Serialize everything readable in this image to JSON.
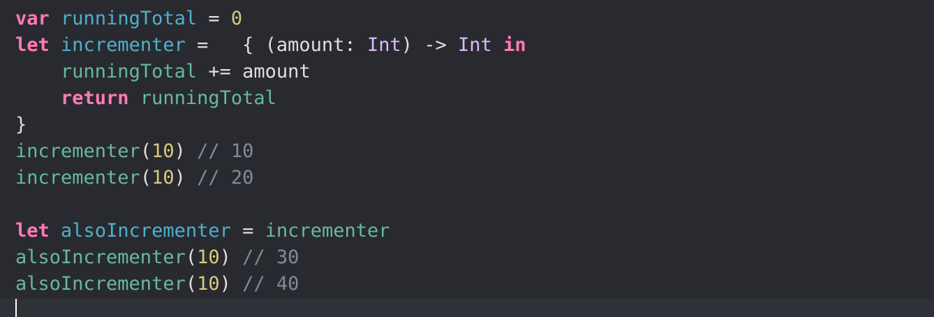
{
  "editor": {
    "lines": [
      {
        "kw": "var",
        "decl": "runningTotal",
        "op": " = ",
        "num": "0"
      },
      {
        "kw": "let",
        "decl": "incrementer",
        "op": " =   { (amount: ",
        "type1": "Int",
        "arrow": ") -> ",
        "type2": "Int",
        "kw2": "in"
      },
      {
        "indent": "    ",
        "ident": "runningTotal",
        "op": " += amount"
      },
      {
        "indent": "    ",
        "kw": "return",
        "ident": "runningTotal"
      },
      {
        "brace": "}"
      },
      {
        "ident": "incrementer",
        "open": "(",
        "num": "10",
        "close": ")",
        "comment": "// 10"
      },
      {
        "ident": "incrementer",
        "open": "(",
        "num": "10",
        "close": ")",
        "comment": "// 20"
      },
      {
        "blank": ""
      },
      {
        "kw": "let",
        "decl": "alsoIncrementer",
        "op": " = ",
        "ident": "incrementer"
      },
      {
        "ident": "alsoIncrementer",
        "open": "(",
        "num": "10",
        "close": ")",
        "comment": "// 30"
      },
      {
        "ident": "alsoIncrementer",
        "open": "(",
        "num": "10",
        "close": ")",
        "comment": "// 40"
      }
    ]
  },
  "colors": {
    "background": "#292a30",
    "keyword": "#ff7ab2",
    "declaration": "#4eb0cc",
    "identifier": "#67b7a4",
    "number": "#d9c97c",
    "type": "#dabaff",
    "comment": "#7f8c98",
    "plain": "#dfdfe0"
  }
}
